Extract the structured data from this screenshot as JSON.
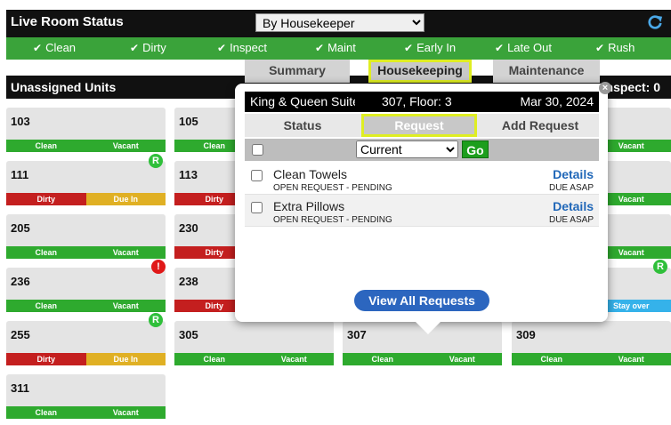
{
  "header": {
    "title": "Live Room Status",
    "view_select": "By Housekeeper"
  },
  "filters": [
    {
      "label": "Clean"
    },
    {
      "label": "Dirty"
    },
    {
      "label": "Inspect"
    },
    {
      "label": "Maint"
    },
    {
      "label": "Early In"
    },
    {
      "label": "Late Out"
    },
    {
      "label": "Rush"
    }
  ],
  "unassigned": {
    "title": "Unassigned Units",
    "inspect_label": "Inspect: 0"
  },
  "popup_tabs": {
    "summary": "Summary",
    "housekeeping": "Housekeeping",
    "maintenance": "Maintenance"
  },
  "popup": {
    "suite": "King & Queen Suite",
    "room": "307, Floor: 3",
    "date": "Mar 30, 2024",
    "subtabs": {
      "status": "Status",
      "request": "Request",
      "add_request": "Add Request"
    },
    "filter_select": "Current",
    "go_label": "Go",
    "requests": [
      {
        "name": "Clean Towels",
        "status": "OPEN REQUEST - PENDING",
        "details": "Details",
        "due": "DUE ASAP"
      },
      {
        "name": "Extra Pillows",
        "status": "OPEN REQUEST - PENDING",
        "details": "Details",
        "due": "DUE ASAP"
      }
    ],
    "view_all": "View All Requests"
  },
  "tiles": [
    {
      "num": "103",
      "left": "Clean",
      "right": "Vacant"
    },
    {
      "num": "105",
      "left": "Clean",
      "right": ""
    },
    {
      "num": "",
      "left": "",
      "right": "Vacant"
    },
    {
      "num": "111",
      "left": "Dirty",
      "right": "Due In",
      "badge": "R"
    },
    {
      "num": "113",
      "left": "Dirty",
      "right": ""
    },
    {
      "num": "",
      "left": "",
      "right": "Vacant"
    },
    {
      "num": "205",
      "left": "Clean",
      "right": "Vacant"
    },
    {
      "num": "230",
      "left": "Dirty",
      "right": ""
    },
    {
      "num": "",
      "left": "",
      "right": "Vacant"
    },
    {
      "num": "236",
      "left": "Clean",
      "right": "Vacant",
      "badge": "!"
    },
    {
      "num": "238",
      "left": "Dirty",
      "right": ""
    },
    {
      "num": "",
      "left": "",
      "right": "Stay over",
      "badge": "R"
    },
    {
      "num": "255",
      "left": "Dirty",
      "right": "Due In",
      "badge": "R"
    },
    {
      "num": "305",
      "left": "Clean",
      "right": "Vacant"
    },
    {
      "num": "307",
      "left": "Clean",
      "right": "Vacant"
    },
    {
      "num": "309",
      "left": "Clean",
      "right": "Vacant"
    },
    {
      "num": "311",
      "left": "Clean",
      "right": "Vacant"
    }
  ],
  "colors": {
    "green": "#2eaa2e",
    "red": "#c41f1f",
    "yellow": "#e0b024",
    "blue": "#35b2ea",
    "highlight": "#dfee22"
  }
}
